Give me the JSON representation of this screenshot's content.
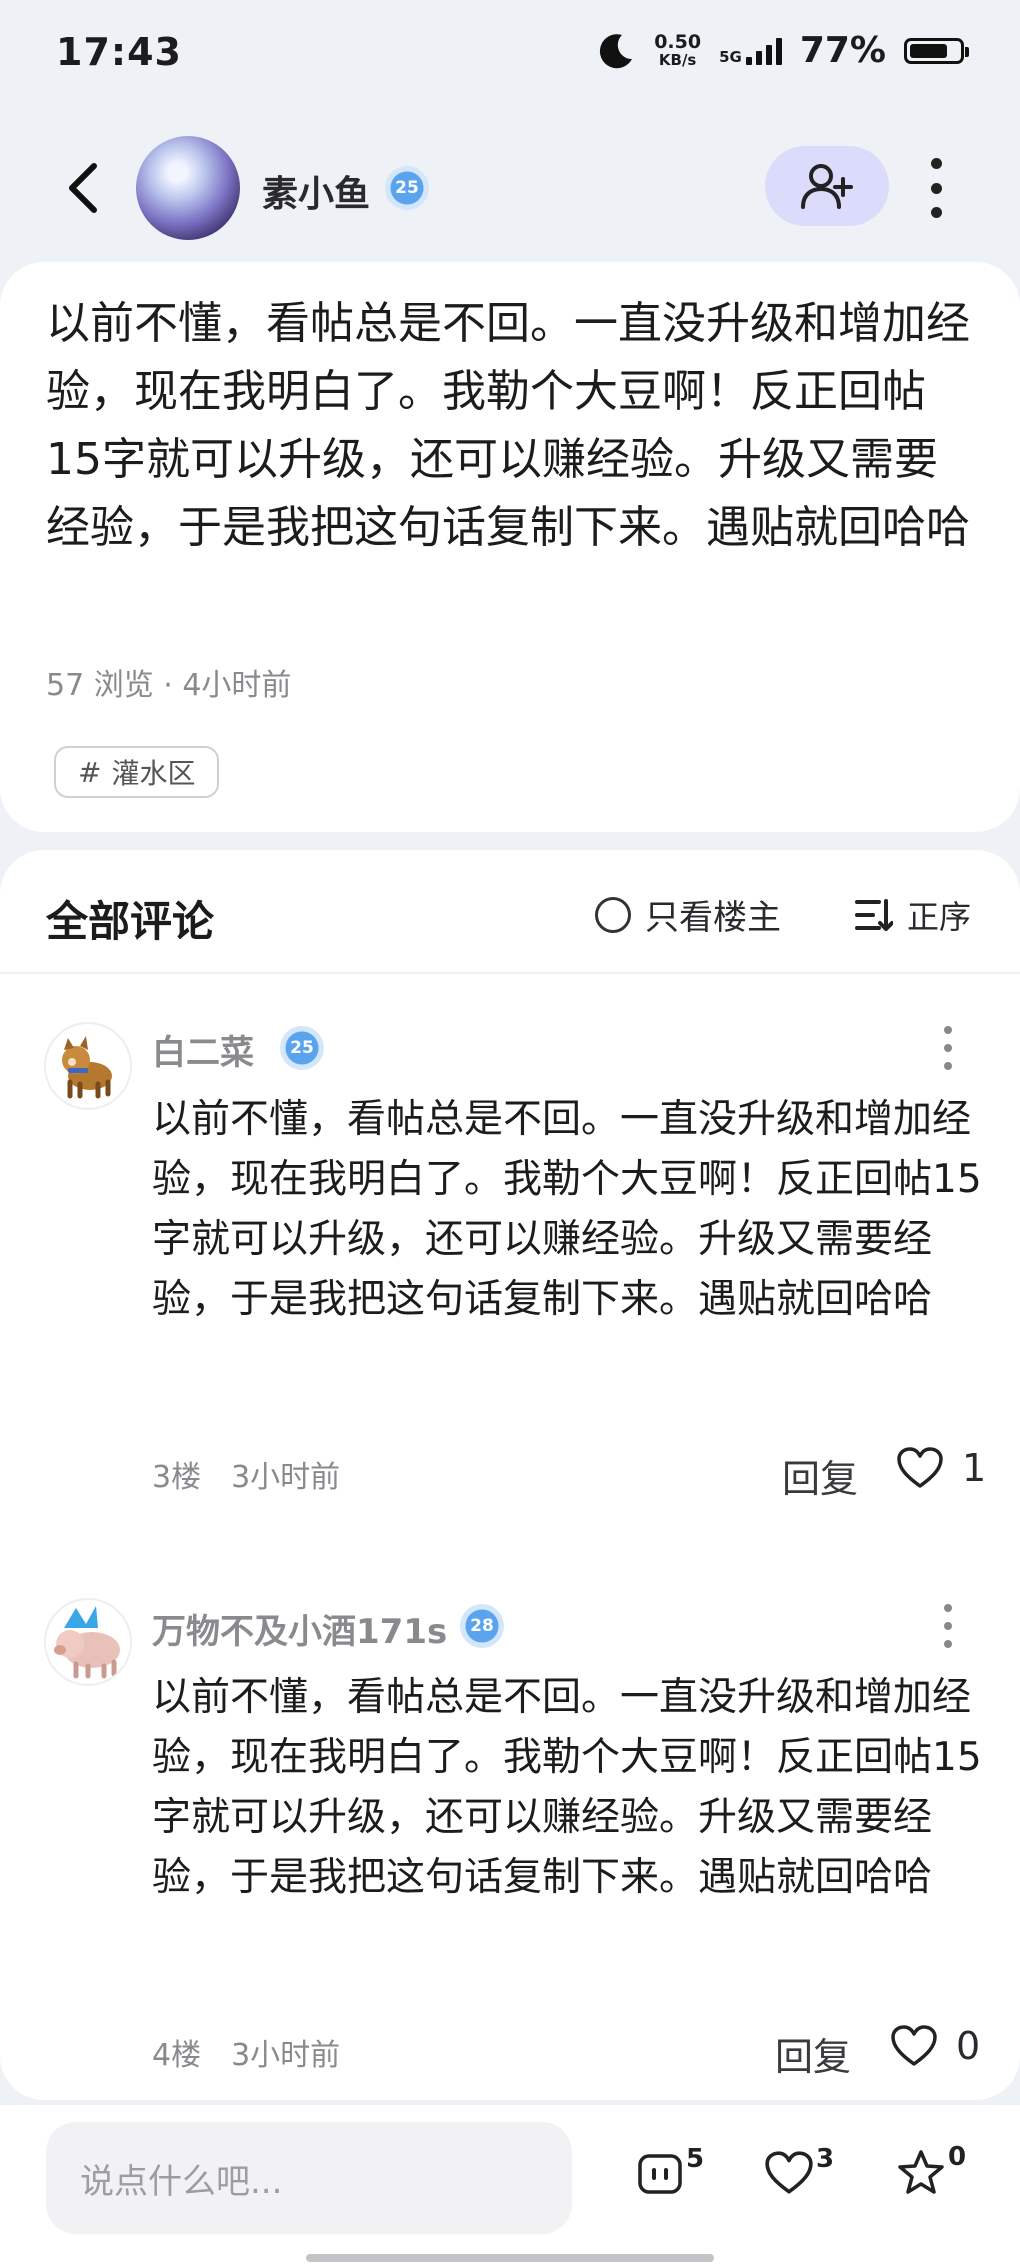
{
  "status_bar": {
    "time": "17:43",
    "net_speed": "0.50",
    "net_unit": "KB/s",
    "network_type": "5G",
    "battery_pct": "77%",
    "battery_level": 0.77
  },
  "header": {
    "author_name": "素小鱼",
    "author_level": "25"
  },
  "post": {
    "content": "以前不懂，看帖总是不回。一直没升级和增加经验，现在我明白了。我勒个大豆啊！反正回帖15字就可以升级，还可以赚经验。升级又需要经验，于是我把这句话复制下来。遇贴就回哈哈",
    "meta": "57 浏览 · 4小时前",
    "tag_icon": "#",
    "tag": "灌水区"
  },
  "comments_section": {
    "title": "全部评论",
    "only_owner_label": "只看楼主",
    "sort_label": "正序"
  },
  "comments": [
    {
      "name": "白二菜",
      "level": "25",
      "content": "以前不懂，看帖总是不回。一直没升级和增加经验，现在我明白了。我勒个大豆啊！反正回帖15字就可以升级，还可以赚经验。升级又需要经验，于是我把这句话复制下来。遇贴就回哈哈",
      "floor": "3楼",
      "time": "3小时前",
      "reply_label": "回复",
      "likes": "1"
    },
    {
      "name": "万物不及小酒171s",
      "level": "28",
      "content": "以前不懂，看帖总是不回。一直没升级和增加经验，现在我明白了。我勒个大豆啊！反正回帖15字就可以升级，还可以赚经验。升级又需要经验，于是我把这句话复制下来。遇贴就回哈哈",
      "floor": "4楼",
      "time": "3小时前",
      "reply_label": "回复",
      "likes": "0"
    }
  ],
  "bottom_bar": {
    "input_placeholder": "说点什么吧...",
    "comment_count": "5",
    "like_count": "3",
    "favorite_count": "0"
  },
  "colors": {
    "page_bg": "#eef1f6",
    "follow_button_bg": "#dbdcfb",
    "level_badge": "#5aa4ee"
  }
}
